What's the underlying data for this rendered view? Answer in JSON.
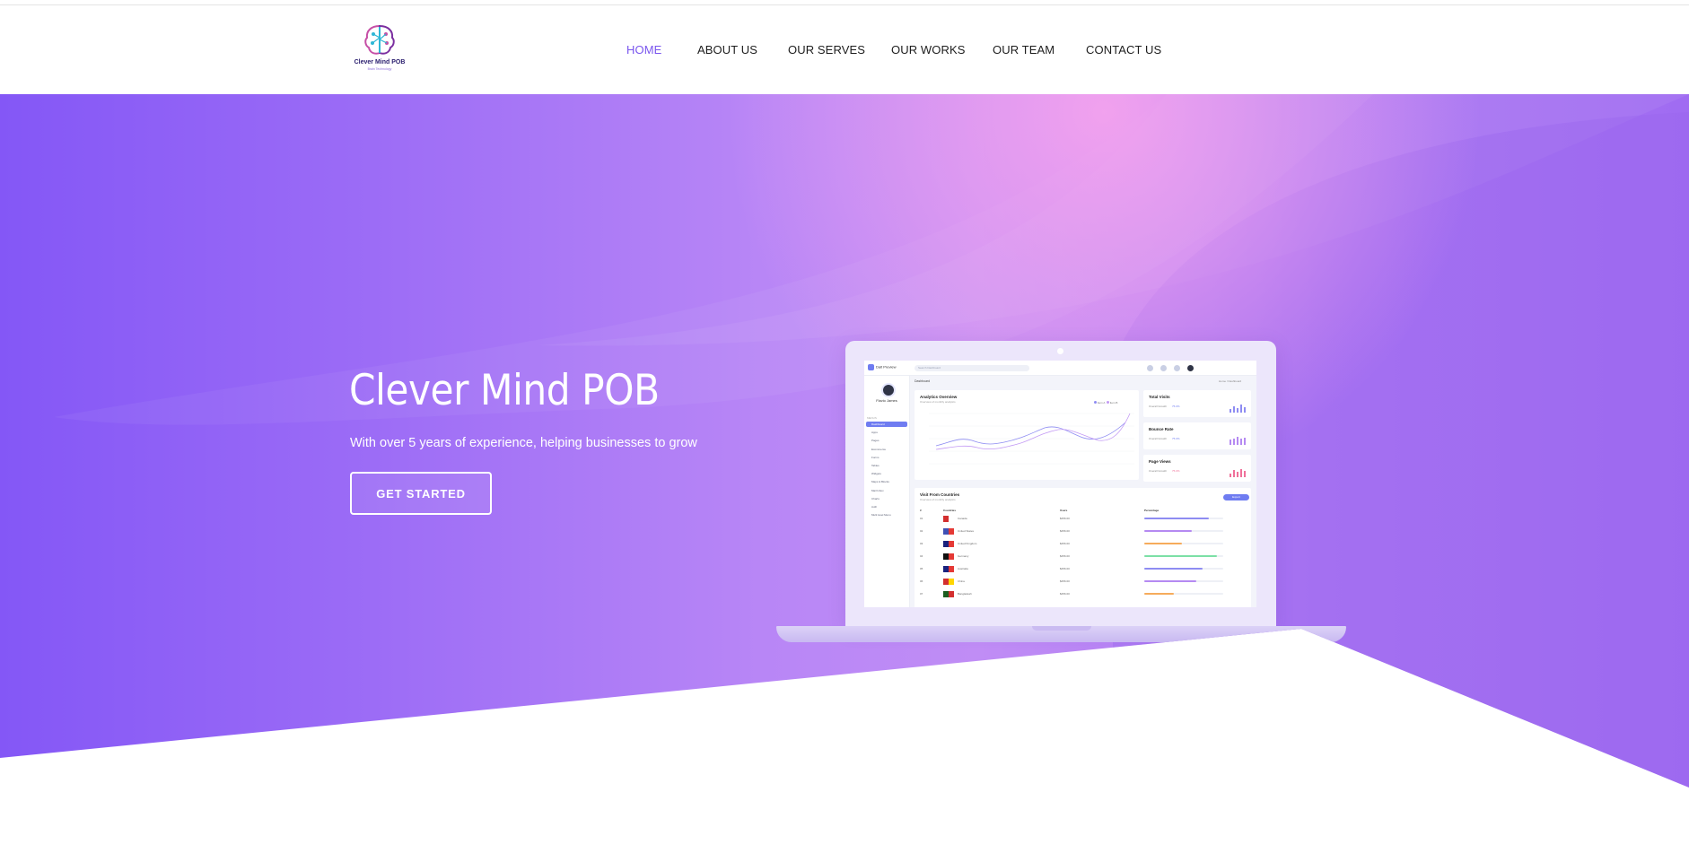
{
  "brand": {
    "name": "Clever Mind POB",
    "tagline": "Brain Technology"
  },
  "nav": {
    "items": [
      {
        "label": "HOME",
        "active": true
      },
      {
        "label": "ABOUT US",
        "active": false
      },
      {
        "label": "OUR SERVES",
        "active": false
      },
      {
        "label": "OUR WORKS",
        "active": false
      },
      {
        "label": "OUR TEAM",
        "active": false
      },
      {
        "label": "CONTACT US",
        "active": false
      }
    ]
  },
  "hero": {
    "title": "Clever Mind POB",
    "subtitle": "With over 5 years of experience, helping businesses to grow",
    "cta_label": "GET STARTED"
  },
  "dashboard": {
    "brand": "Dalt Preview",
    "search_placeholder": "Search Dashboard",
    "user_name": "Flavio James",
    "menu_label": "MENUS",
    "menu_items": [
      "Dashboard",
      "Apps",
      "Pages",
      "Ecommerce",
      "Forms",
      "Tables",
      "Widgets",
      "Maps & Blocks",
      "Mail Inbox",
      "Charts",
      "Auth",
      "Multi level Menu"
    ],
    "breadcrumb": "Dashboard",
    "breadcrumb_right": "Home  /  Dashboard",
    "analytics": {
      "title": "Analytics Overview",
      "subtitle": "Overview of monthly analytics",
      "legend": [
        "Item A",
        "Item B"
      ]
    },
    "stats": [
      {
        "title": "Total Visits",
        "label": "Overall Growth",
        "value": "75.0%"
      },
      {
        "title": "Bounce Rate",
        "label": "Overall Growth",
        "value": "75.0%"
      },
      {
        "title": "Page Views",
        "label": "Overall Growth",
        "value": "75.0%"
      }
    ],
    "countries_card": {
      "title": "Visit From Countries",
      "subtitle": "Overview of monthly analytics",
      "button": "Export",
      "headers": [
        "#",
        "Countries",
        "Users",
        "Percentage"
      ],
      "rows": [
        {
          "num": "01",
          "country": "Canada",
          "users": "$456.00",
          "pct": 0.82,
          "color": "#8e8cf2"
        },
        {
          "num": "02",
          "country": "United States",
          "users": "$456.00",
          "pct": 0.6,
          "color": "#b58af2"
        },
        {
          "num": "03",
          "country": "United Kingdom",
          "users": "$456.00",
          "pct": 0.48,
          "color": "#f6ab5b"
        },
        {
          "num": "04",
          "country": "Germany",
          "users": "$456.00",
          "pct": 0.92,
          "color": "#7ce0a6"
        },
        {
          "num": "05",
          "country": "Australia",
          "users": "$456.00",
          "pct": 0.74,
          "color": "#8e8cf2"
        },
        {
          "num": "06",
          "country": "China",
          "users": "$456.00",
          "pct": 0.66,
          "color": "#b58af2"
        },
        {
          "num": "07",
          "country": "Bangladesh",
          "users": "$456.00",
          "pct": 0.38,
          "color": "#f6ab5b"
        }
      ]
    }
  }
}
